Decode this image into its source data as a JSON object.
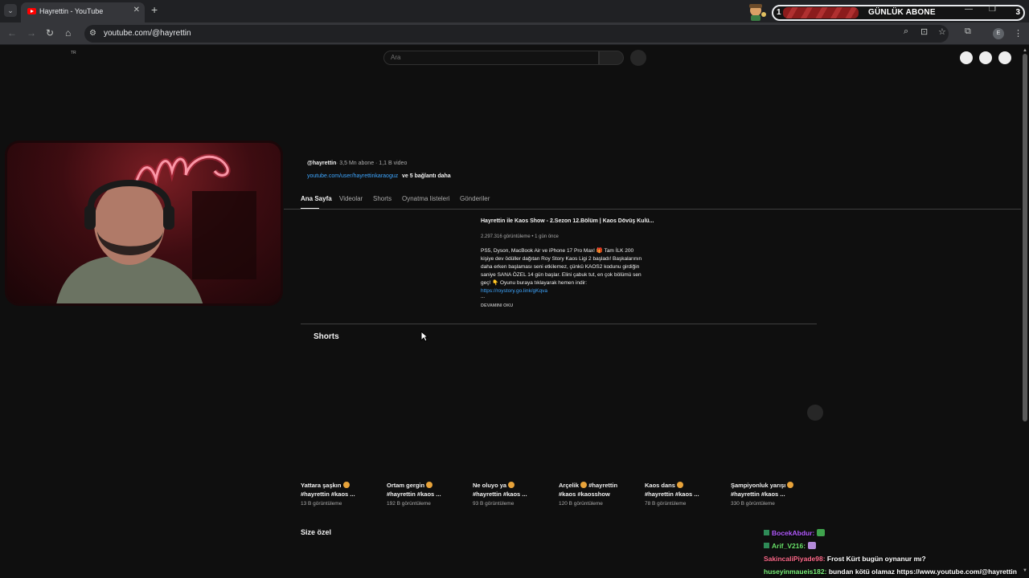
{
  "browser": {
    "tab_title": "Hayrettin - YouTube",
    "url": "youtube.com/@hayrettin",
    "profile_initial": "E"
  },
  "overlay": {
    "goal_label": "GÜNLÜK ABONE",
    "goal_current": "1",
    "goal_target": "3",
    "goal_progress_fraction": 0.33
  },
  "youtube": {
    "locale": "TR",
    "search_placeholder": "Ara",
    "channel": {
      "handle": "@hayrettin",
      "meta": "· 3,5 Mn abone · 1,1 B video",
      "link": "youtube.com/user/hayrettinkaraoguz",
      "more_links": "ve 5 bağlantı daha"
    },
    "tabs": [
      "Ana Sayfa",
      "Videolar",
      "Shorts",
      "Oynatma listeleri",
      "Gönderiler"
    ],
    "featured": {
      "title": "Hayrettin ile Kaos Show - 2.Sezon 12.Bölüm | Kaos Dövüş Kulü...",
      "meta": "2.297.316 görüntüleme • 1 gün önce",
      "description": "PS5, Dyson, MacBook Air ve iPhone 17 Pro Max! 🎁 Tam İLK 200 kişiye dev ödüller dağıtan Roy Story Kaos Ligi 2 başladı! Başkalarının daha erken başlaması seni etkilemez, çünkü KAOS2 kodunu girdiğin saniye SANA ÖZEL 14 gün başlar. Elini çabuk tut, en çok bölümü sen geç! 👇 Oyunu buraya tıklayarak hemen indir:",
      "description_link": "https://roystory.go.link/gKqva",
      "ellipsis": "...",
      "read_more": "DEVAMINI OKU"
    },
    "shorts_section_title": "Shorts",
    "shorts": [
      {
        "line1": "Yattara şaşkın",
        "line2": "#hayrettin #kaos ...",
        "views": "13 B görüntüleme"
      },
      {
        "line1": "Ortam gergin",
        "line2": "#hayrettin #kaos ...",
        "views": "192 B görüntüleme"
      },
      {
        "line1": "Ne oluyo ya",
        "line2": "#hayrettin #kaos ...",
        "views": "93 B görüntüleme"
      },
      {
        "line1": "Arçelik",
        "line1b": "#hayrettin",
        "line2": "#kaos #kaosshow",
        "views": "120 B görüntüleme"
      },
      {
        "line1": "Kaos dans",
        "line2": "#hayrettin #kaos ...",
        "views": "78 B görüntüleme"
      },
      {
        "line1": "Şampiyonluk yarışı",
        "line2": "#hayrettin #kaos ...",
        "views": "330 B görüntüleme"
      }
    ],
    "for_you_title": "Size özel"
  },
  "chat": [
    {
      "user": "BocekAbdur:",
      "user_color": "#b45cff",
      "message": "",
      "emote_color": "#3fa34d"
    },
    {
      "user": "Arif_V216:",
      "user_color": "#6be36b",
      "message": "",
      "emote_color": "#b38bd9"
    },
    {
      "user": "SakincaliPiyade98:",
      "user_color": "#ff6b8b",
      "message": "Frost Kürt bugün oynanur mı?"
    },
    {
      "user": "huseyinmaueis182:",
      "user_color": "#7cf27c",
      "message": "bundan kötü olamaz https://www.youtube.com/@hayrettin"
    }
  ],
  "colors": {
    "page_bg": "#0f0f0f",
    "link": "#3ea6ff",
    "browser_chrome": "#35363a"
  }
}
